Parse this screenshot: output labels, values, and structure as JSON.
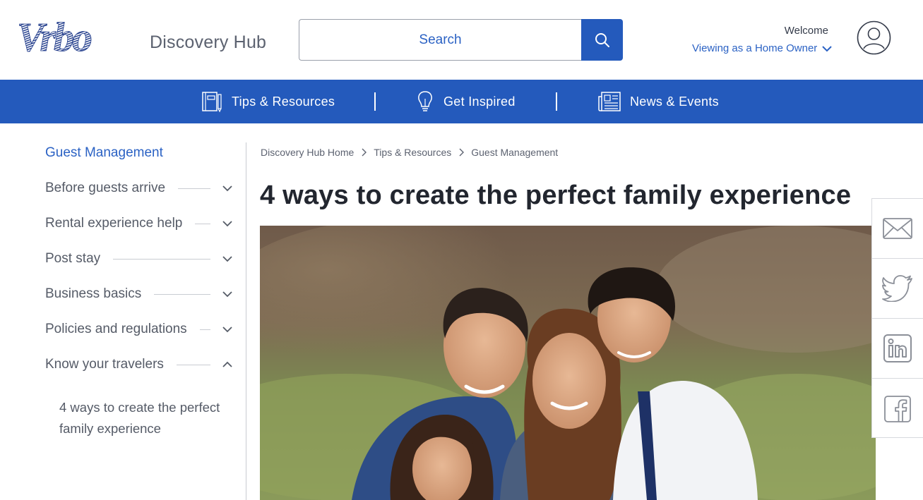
{
  "header": {
    "logo_text": "Vrbo",
    "hub_title": "Discovery Hub",
    "search_placeholder": "Search",
    "welcome": "Welcome",
    "viewing_as": "Viewing as a Home Owner"
  },
  "nav": {
    "items": [
      {
        "label": "Tips & Resources",
        "icon": "notebook-icon"
      },
      {
        "label": "Get Inspired",
        "icon": "lightbulb-icon"
      },
      {
        "label": "News & Events",
        "icon": "newspaper-icon"
      }
    ]
  },
  "sidebar": {
    "heading": "Guest Management",
    "items": [
      {
        "label": "Before guests arrive",
        "state": "collapsed"
      },
      {
        "label": "Rental experience help",
        "state": "collapsed"
      },
      {
        "label": "Post stay",
        "state": "collapsed"
      },
      {
        "label": "Business basics",
        "state": "collapsed"
      },
      {
        "label": "Policies and regulations",
        "state": "collapsed"
      },
      {
        "label": "Know your travelers",
        "state": "expanded"
      }
    ],
    "sub_item": "4 ways to create the perfect family experience"
  },
  "breadcrumb": [
    "Discovery Hub Home",
    "Tips & Resources",
    "Guest Management"
  ],
  "article": {
    "title": "4 ways to create the perfect family experience"
  },
  "share": [
    "email-icon",
    "twitter-icon",
    "linkedin-icon",
    "facebook-icon"
  ],
  "colors": {
    "brand_blue": "#245abc",
    "link_blue": "#2b62c4",
    "text_dark": "#22262f",
    "text_muted": "#555b67"
  }
}
